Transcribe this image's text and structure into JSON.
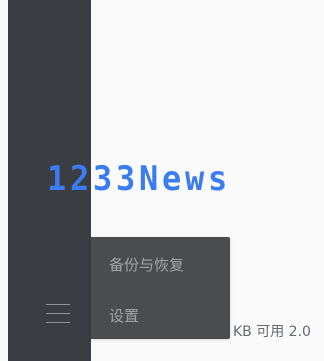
{
  "sidebar": {
    "menu_icon": "hamburger-menu-icon"
  },
  "watermark": {
    "text": "1233News"
  },
  "popup_menu": {
    "items": [
      {
        "label": "备份与恢复"
      },
      {
        "label": "设置"
      }
    ]
  },
  "status": {
    "storage_text": "KB 可用 2.0"
  },
  "colors": {
    "sidebar_bg": "#3a3d41",
    "menu_bg": "#4b4c4d",
    "menu_text": "#a1a5aa",
    "watermark": "#3c7cf2",
    "status_text": "#666a70",
    "page_bg": "#fafafa"
  }
}
